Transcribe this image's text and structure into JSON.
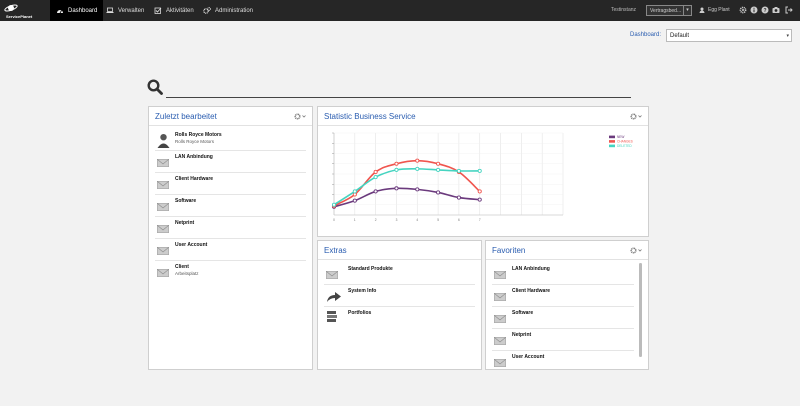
{
  "brand": {
    "name": "ServicePlanet"
  },
  "nav": {
    "items": [
      {
        "label": "Dashboard",
        "icon": "dashboard-icon",
        "active": true
      },
      {
        "label": "Verwalten",
        "icon": "laptop-icon",
        "active": false
      },
      {
        "label": "Aktivitäten",
        "icon": "checkbox-icon",
        "active": false
      },
      {
        "label": "Administration",
        "icon": "gears-icon",
        "active": false
      }
    ],
    "instance": "Testinstanz",
    "contract_select": "Vertragsbed...",
    "user": "Egg Plant",
    "tools": [
      "gear-icon",
      "info-icon",
      "help-icon",
      "camera-icon",
      "logout-icon"
    ]
  },
  "dashboard": {
    "label": "Dashboard:",
    "selected": "Default"
  },
  "search": {
    "placeholder": ""
  },
  "recent": {
    "title": "Zuletzt bearbeitet",
    "items": [
      {
        "title": "Rolls Royce Motors",
        "subtitle": "Rolls Royce Motors",
        "icon": "person-icon"
      },
      {
        "title": "LAN Anbindung",
        "subtitle": "",
        "icon": "envelope-icon"
      },
      {
        "title": "Client Hardware",
        "subtitle": "",
        "icon": "envelope-icon"
      },
      {
        "title": "Software",
        "subtitle": "",
        "icon": "envelope-icon"
      },
      {
        "title": "Netprint",
        "subtitle": "",
        "icon": "envelope-icon"
      },
      {
        "title": "User Account",
        "subtitle": "",
        "icon": "envelope-icon"
      },
      {
        "title": "Client",
        "subtitle": "Arbeitsplatz",
        "icon": "envelope-icon"
      }
    ]
  },
  "stat": {
    "title": "Statistic Business Service"
  },
  "extras": {
    "title": "Extras",
    "items": [
      {
        "title": "Standard Produkte",
        "icon": "envelope-icon"
      },
      {
        "title": "System Info",
        "icon": "share-arrow-icon"
      },
      {
        "title": "Portfolios",
        "icon": "stack-icon"
      }
    ]
  },
  "favorites": {
    "title": "Favoriten",
    "items": [
      {
        "title": "LAN Anbindung",
        "icon": "envelope-icon"
      },
      {
        "title": "Client Hardware",
        "icon": "envelope-icon"
      },
      {
        "title": "Software",
        "icon": "envelope-icon"
      },
      {
        "title": "Netprint",
        "icon": "envelope-icon"
      },
      {
        "title": "User Account",
        "icon": "envelope-icon"
      }
    ]
  },
  "chart_data": {
    "type": "line",
    "x": [
      0,
      1,
      2,
      3,
      4,
      5,
      6,
      7
    ],
    "xlim": [
      0,
      11
    ],
    "ylim": [
      0,
      8
    ],
    "grid": true,
    "legend_position": "top-right",
    "series": [
      {
        "name": "NEW",
        "color": "#6b3a7d",
        "values": [
          0.8,
          1.4,
          2.3,
          2.6,
          2.5,
          2.2,
          1.7,
          1.5
        ]
      },
      {
        "name": "CHANGES",
        "color": "#f0554e",
        "values": [
          0.9,
          2.0,
          4.2,
          5.0,
          5.3,
          5.0,
          4.2,
          2.3
        ]
      },
      {
        "name": "DELETED",
        "color": "#45d4c0",
        "values": [
          1.0,
          2.3,
          3.7,
          4.4,
          4.5,
          4.4,
          4.3,
          4.3
        ]
      }
    ]
  }
}
